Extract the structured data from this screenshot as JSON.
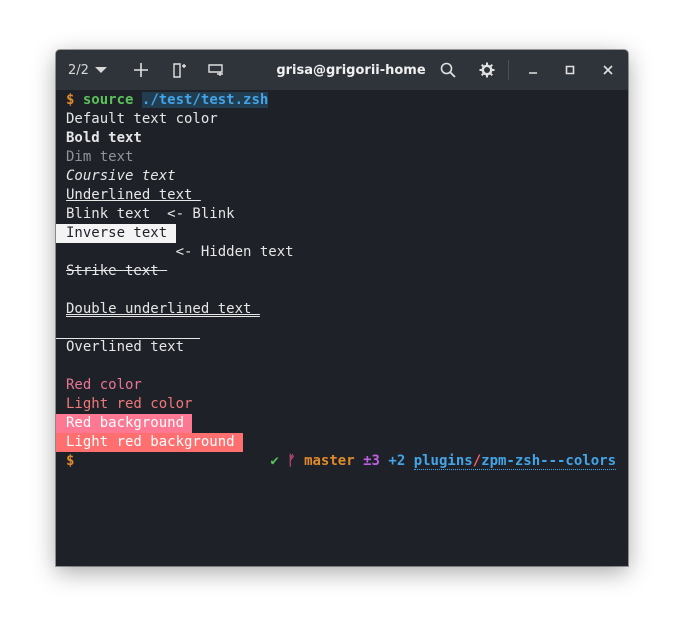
{
  "titlebar": {
    "tab_counter": "2/2",
    "title": "grisa@grigorii-home"
  },
  "terminal": {
    "command": {
      "prompt": "$",
      "keyword": "source",
      "path": "./test/test.zsh"
    },
    "lines": {
      "default": "Default text color",
      "bold": "Bold text",
      "dim": "Dim text",
      "italic": "Coursive text",
      "underlined": "Underlined text ",
      "blink": "Blink text  <- Blink",
      "inverse": "Inverse text ",
      "hidden": "             <- Hidden text",
      "strike": "Strike text ",
      "double_underlined": "Double underlined text ",
      "overlined": "Overlined text",
      "red": "Red color",
      "light_red": "Light red color",
      "red_bg": "Red background ",
      "light_red_bg": "Light red background "
    },
    "prompt": {
      "symbol": "$",
      "check": "✔",
      "branch_icon": "ᚠ",
      "branch": "master",
      "changes": "±3",
      "added": "+2",
      "dir": "plugins",
      "slash": "/",
      "repo": "zpm-zsh---colors"
    }
  },
  "colors": {
    "background": "#1e2228",
    "titlebar": "#2f343a",
    "green": "#5bc25b",
    "orange": "#e08a2b",
    "blue": "#44a4e8",
    "red": "#ea7491",
    "red_bg": "#ff7893",
    "light_red_bg": "#ff6f6f"
  }
}
